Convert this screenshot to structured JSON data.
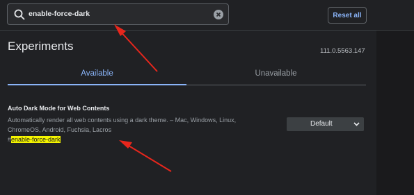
{
  "search": {
    "value": "enable-force-dark",
    "icon": "search-icon",
    "clear_icon": "clear-icon"
  },
  "toolbar": {
    "reset_label": "Reset all"
  },
  "header": {
    "title": "Experiments",
    "version": "111.0.5563.147"
  },
  "tabs": [
    {
      "label": "Available",
      "active": true
    },
    {
      "label": "Unavailable",
      "active": false
    }
  ],
  "experiment": {
    "title": "Auto Dark Mode for Web Contents",
    "description": "Automatically render all web contents using a dark theme. – Mac, Windows, Linux, ChromeOS, Android, Fuchsia, Lacros",
    "hash": "#",
    "link": "enable-force-dark",
    "select_value": "Default"
  },
  "colors": {
    "accent": "#8ab4f8",
    "highlight": "#f5f500",
    "annotation_arrow": "#e8261c"
  }
}
